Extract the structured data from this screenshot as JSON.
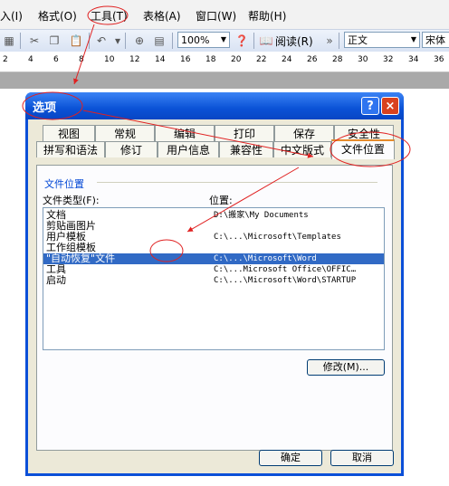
{
  "menubar": {
    "items": [
      "入(I)",
      "格式(O)",
      "工具(T)",
      "表格(A)",
      "窗口(W)",
      "帮助(H)"
    ]
  },
  "toolbar": {
    "zoom": "100%",
    "read_label": "阅读(R)",
    "style_value": "正文",
    "font_value": "宋体"
  },
  "ruler": {
    "ticks": [
      "2",
      "4",
      "6",
      "8",
      "10",
      "12",
      "14",
      "16",
      "18",
      "20",
      "22",
      "24",
      "26",
      "28",
      "30",
      "32",
      "34",
      "36"
    ]
  },
  "dialog": {
    "title": "选项",
    "help_glyph": "?",
    "close_glyph": "×",
    "tabs_row1": [
      "视图",
      "常规",
      "编辑",
      "打印",
      "保存",
      "安全性"
    ],
    "tabs_row2": [
      "拼写和语法",
      "修订",
      "用户信息",
      "兼容性",
      "中文版式",
      "文件位置"
    ],
    "group_label": "文件位置",
    "col_type": "文件类型(F):",
    "col_location": "位置:",
    "rows": [
      {
        "type": "文档",
        "location": "D:\\搬家\\My Documents"
      },
      {
        "type": "剪贴画图片",
        "location": ""
      },
      {
        "type": "用户模板",
        "location": "C:\\...\\Microsoft\\Templates"
      },
      {
        "type": "工作组模板",
        "location": ""
      },
      {
        "type": "\"自动恢复\"文件",
        "location": "C:\\...\\Microsoft\\Word"
      },
      {
        "type": "工具",
        "location": "C:\\...Microsoft Office\\OFFIC…"
      },
      {
        "type": "启动",
        "location": "C:\\...\\Microsoft\\Word\\STARTUP"
      }
    ],
    "selected_row": 4,
    "modify_button": "修改(M)...",
    "ok_button": "确定",
    "cancel_button": "取消"
  },
  "annotation_color": "#e02020"
}
